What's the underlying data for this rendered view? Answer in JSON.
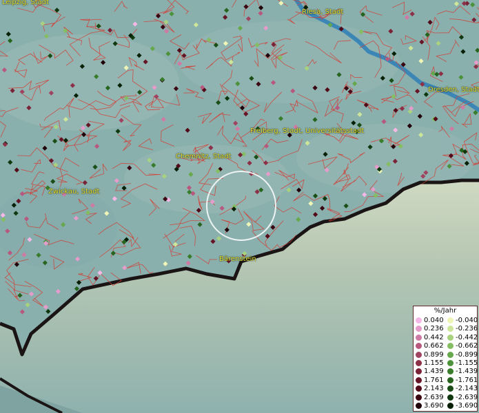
{
  "cities": [
    {
      "name": "Leipzig, Stadt"
    },
    {
      "name": "Riesa, Stadt"
    },
    {
      "name": "Dresden, Stadt"
    },
    {
      "name": "Freiberg, Stadt, Universitätsstadt"
    },
    {
      "name": "Chemnitz, Stadt"
    },
    {
      "name": "Zwickau, Stadt"
    },
    {
      "name": "Bärenstein"
    }
  ],
  "legend": {
    "title": "%/Jahr",
    "positive": [
      {
        "label": "0.040",
        "color": "#f5b8e6"
      },
      {
        "label": "0.236",
        "color": "#e59ccb"
      },
      {
        "label": "0.442",
        "color": "#cf7aa5"
      },
      {
        "label": "0.662",
        "color": "#b8587f"
      },
      {
        "label": "0.899",
        "color": "#a04360"
      },
      {
        "label": "1.155",
        "color": "#8c3048"
      },
      {
        "label": "1.439",
        "color": "#7a2236"
      },
      {
        "label": "1.761",
        "color": "#661426"
      },
      {
        "label": "2.143",
        "color": "#520a18"
      },
      {
        "label": "2.639",
        "color": "#3a0510"
      },
      {
        "label": "3.690",
        "color": "#200008"
      }
    ],
    "negative": [
      {
        "label": "-0.040",
        "color": "#eef5b6"
      },
      {
        "label": "-0.236",
        "color": "#cde69a"
      },
      {
        "label": "-0.442",
        "color": "#a9d27e"
      },
      {
        "label": "-0.662",
        "color": "#85be62"
      },
      {
        "label": "-0.899",
        "color": "#66a84c"
      },
      {
        "label": "-1.155",
        "color": "#4c923a"
      },
      {
        "label": "-1.439",
        "color": "#387c2c"
      },
      {
        "label": "-1.761",
        "color": "#27641f"
      },
      {
        "label": "-2.143",
        "color": "#1a4e16"
      },
      {
        "label": "-2.639",
        "color": "#0f380e"
      },
      {
        "label": "-3.690",
        "color": "#062006"
      }
    ]
  }
}
